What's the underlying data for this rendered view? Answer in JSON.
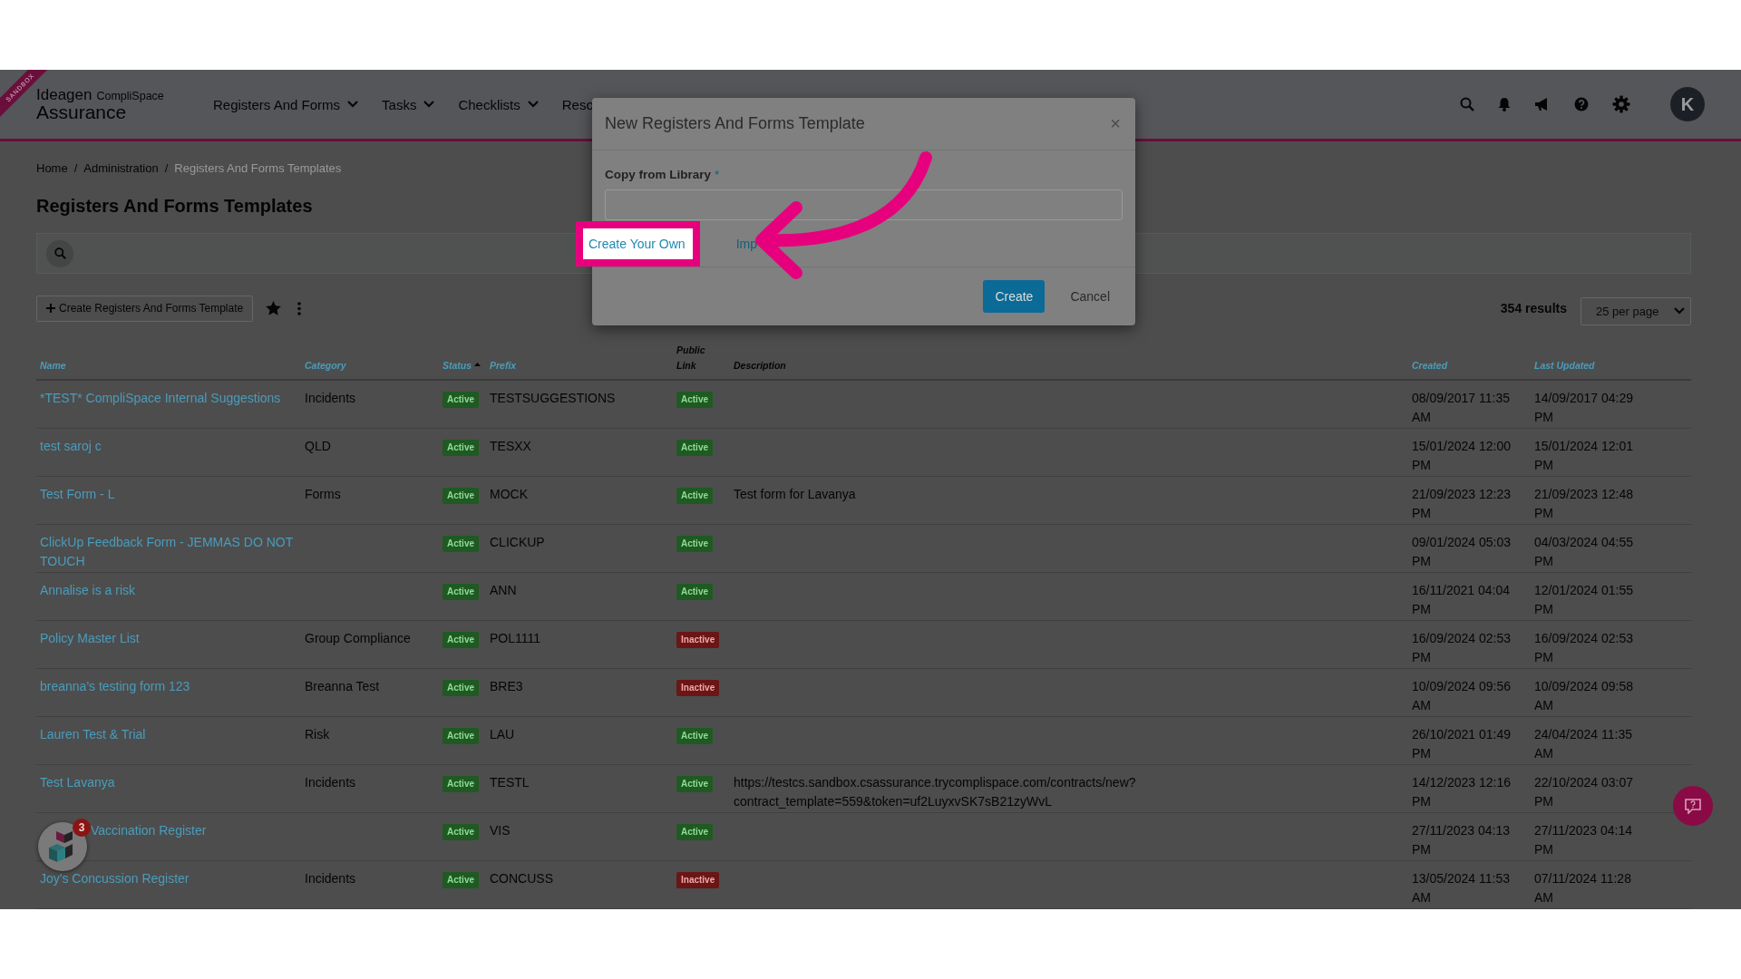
{
  "header": {
    "sandbox_ribbon": "SANDBOX",
    "logo": {
      "brand": "Ideagen",
      "product": "CompliSpace",
      "subtitle": "Assurance"
    },
    "nav": [
      {
        "label": "Registers And Forms",
        "dropdown": true
      },
      {
        "label": "Tasks",
        "dropdown": true
      },
      {
        "label": "Checklists",
        "dropdown": true
      },
      {
        "label": "Reso",
        "dropdown": false
      }
    ],
    "avatar": "K"
  },
  "breadcrumbs": [
    {
      "label": "Home",
      "current": false
    },
    {
      "separator": "/",
      "label": "Administration",
      "current": false
    },
    {
      "separator": "/",
      "label": "Registers And Forms Templates",
      "current": true
    }
  ],
  "page_title": "Registers And Forms Templates",
  "toolbar": {
    "create_button": "Create Registers And Forms Template",
    "results": "354 results",
    "per_page": "25 per page"
  },
  "table": {
    "columns": [
      {
        "label": "Name",
        "sortable": true,
        "sorted": false
      },
      {
        "label": "Category",
        "sortable": true,
        "sorted": false
      },
      {
        "label": "Status",
        "sortable": true,
        "sorted": true
      },
      {
        "label": "Prefix",
        "sortable": true,
        "sorted": false
      },
      {
        "label": "Public Link",
        "sortable": false,
        "sorted": false
      },
      {
        "label": "Description",
        "sortable": false,
        "sorted": false
      },
      {
        "label": "Created",
        "sortable": true,
        "sorted": false
      },
      {
        "label": "Last Updated",
        "sortable": true,
        "sorted": false
      }
    ],
    "rows": [
      {
        "name": "*TEST* CompliSpace Internal Suggestions",
        "category": "Incidents",
        "status": {
          "label": "Active",
          "active": true
        },
        "prefix": "TESTSUGGESTIONS",
        "public_link": {
          "label": "Active",
          "active": true
        },
        "created": "08/09/2017 11:35 AM",
        "last_updated": "14/09/2017 04:29 PM"
      },
      {
        "name": "test saroj c",
        "category": "QLD",
        "status": {
          "label": "Active",
          "active": true
        },
        "prefix": "TESXX",
        "public_link": {
          "label": "Active",
          "active": true
        },
        "created": "15/01/2024 12:00 PM",
        "last_updated": "15/01/2024 12:01 PM"
      },
      {
        "name": "Test Form - L",
        "category": "Forms",
        "status": {
          "label": "Active",
          "active": true
        },
        "prefix": "MOCK",
        "public_link": {
          "label": "Active",
          "active": true
        },
        "description": "Test form for Lavanya",
        "created": "21/09/2023 12:23 PM",
        "last_updated": "21/09/2023 12:48 PM"
      },
      {
        "name": "ClickUp Feedback Form - JEMMAS DO NOT TOUCH",
        "status": {
          "label": "Active",
          "active": true
        },
        "prefix": "CLICKUP",
        "public_link": {
          "label": "Active",
          "active": true
        },
        "created": "09/01/2024 05:03 PM",
        "last_updated": "04/03/2024 04:55 PM"
      },
      {
        "name": "Annalise is a risk",
        "status": {
          "label": "Active",
          "active": true
        },
        "prefix": "ANN",
        "public_link": {
          "label": "Active",
          "active": true
        },
        "created": "16/11/2021 04:04 PM",
        "last_updated": "12/01/2024 01:55 PM"
      },
      {
        "name": "Policy Master List",
        "category": "Group Compliance",
        "status": {
          "label": "Active",
          "active": true
        },
        "prefix": "POL1111",
        "public_link": {
          "label": "Inactive",
          "active": false
        },
        "created": "16/09/2024 02:53 PM",
        "last_updated": "16/09/2024 02:53 PM"
      },
      {
        "name": "breanna's testing form 123",
        "category": "Breanna Test",
        "status": {
          "label": "Active",
          "active": true
        },
        "prefix": "BRE3",
        "public_link": {
          "label": "Inactive",
          "active": false
        },
        "created": "10/09/2024 09:56 AM",
        "last_updated": "10/09/2024 09:58 AM"
      },
      {
        "name": "Lauren Test & Trial",
        "category": "Risk",
        "status": {
          "label": "Active",
          "active": true
        },
        "prefix": "LAU",
        "public_link": {
          "label": "Active",
          "active": true
        },
        "created": "26/10/2021 01:49 PM",
        "last_updated": "24/04/2024 11:35 AM"
      },
      {
        "name": "Test Lavanya",
        "category": "Incidents",
        "status": {
          "label": "Active",
          "active": true
        },
        "prefix": "TESTL",
        "public_link": {
          "label": "Active",
          "active": true
        },
        "description": "https://testcs.sandbox.csassurance.trycomplispace.com/contracts/new?\ncontract_template=559&token=uf2LuyxvSK7sB21zyWvL",
        "created": "14/12/2023 12:16 PM",
        "last_updated": "22/10/2024 03:07 PM"
      },
      {
        "name": "Vaccination Register",
        "partly_hidden": true,
        "status": {
          "label": "Active",
          "active": true
        },
        "prefix": "VIS",
        "public_link": {
          "label": "Active",
          "active": true
        },
        "created": "27/11/2023 04:13 PM",
        "last_updated": "27/11/2023 04:14 PM"
      },
      {
        "name": "Joy's Concussion Register",
        "category": "Incidents",
        "status": {
          "label": "Active",
          "active": true
        },
        "prefix": "CONCUSS",
        "public_link": {
          "label": "Inactive",
          "active": false
        },
        "created": "13/05/2024 11:53 AM",
        "last_updated": "07/11/2024 11:28 AM"
      }
    ]
  },
  "modal": {
    "title": "New Registers And Forms Template",
    "close": "×",
    "field_label": "Copy from Library",
    "required_mark": "*",
    "links": [
      {
        "label": "Create Your Own",
        "highlighted": true
      },
      {
        "label": "Imp",
        "highlighted": false
      }
    ],
    "primary_button": "Create",
    "cancel_button": "Cancel"
  },
  "help_widget": {
    "badge": "3"
  }
}
